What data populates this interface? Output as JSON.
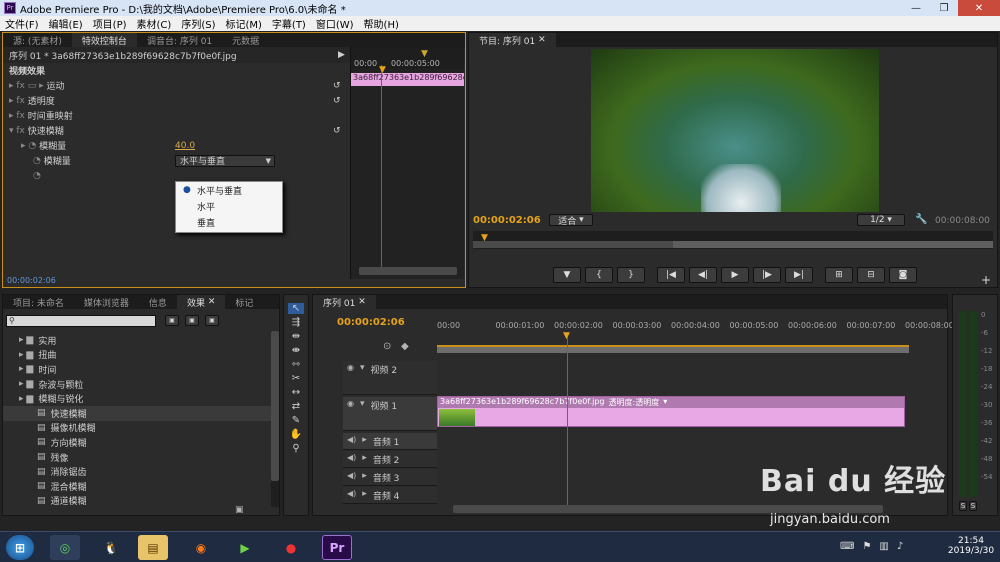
{
  "window": {
    "title": "Adobe Premiere Pro - D:\\我的文档\\Adobe\\Premiere Pro\\6.0\\未命名 *",
    "badge": "Pr"
  },
  "menu": [
    "文件(F)",
    "编辑(E)",
    "项目(P)",
    "素材(C)",
    "序列(S)",
    "标记(M)",
    "字幕(T)",
    "窗口(W)",
    "帮助(H)"
  ],
  "left_top": {
    "tabs": [
      "源: (无素材)",
      "特效控制台",
      "调音台: 序列 01",
      "元数据"
    ],
    "clip_header": "序列 01 * 3a68ff27363e1b289f69628c7b7f0e0f.jpg",
    "video_effects": "视频效果",
    "effects": [
      {
        "label": "运动"
      },
      {
        "label": "透明度"
      },
      {
        "label": "时间重映射"
      },
      {
        "label": "快速模糊"
      }
    ],
    "params": [
      {
        "label": "模糊量",
        "value": "40.0"
      },
      {
        "label": "模糊量",
        "value": "水平与垂直"
      }
    ],
    "dropdown": [
      "水平与垂直",
      "水平",
      "垂直"
    ],
    "mini_ruler": [
      "00:00",
      "00:00:05:00"
    ],
    "mini_clip": "3a68ff27363e1b289f69628c",
    "timecode": "00:00:02:06"
  },
  "program": {
    "tab": "节目: 序列 01",
    "timecode": "00:00:02:06",
    "fit": "适合",
    "ratio": "1/2",
    "duration": "00:00:08:00",
    "transport": [
      "▼",
      "{",
      "}",
      "|◀",
      "◀|",
      "▶",
      "|▶",
      "▶|",
      "⊞",
      "⊟",
      "◙"
    ]
  },
  "project": {
    "tabs": [
      "项目: 未命名",
      "媒体浏览器",
      "信息",
      "效果",
      "标记"
    ],
    "tree": [
      {
        "label": "实用",
        "level": 1
      },
      {
        "label": "扭曲",
        "level": 1
      },
      {
        "label": "时间",
        "level": 1
      },
      {
        "label": "杂波与颗粒",
        "level": 1
      },
      {
        "label": "模糊与锐化",
        "level": 1
      },
      {
        "label": "快速模糊",
        "level": 2
      },
      {
        "label": "摄像机模糊",
        "level": 2
      },
      {
        "label": "方向模糊",
        "level": 2
      },
      {
        "label": "残像",
        "level": 2
      },
      {
        "label": "消除锯齿",
        "level": 2
      },
      {
        "label": "混合模糊",
        "level": 2
      },
      {
        "label": "通道模糊",
        "level": 2
      }
    ]
  },
  "timeline": {
    "tab": "序列 01",
    "timecode": "00:00:02:06",
    "ruler": [
      "00:00",
      "00:00:01:00",
      "00:00:02:00",
      "00:00:03:00",
      "00:00:04:00",
      "00:00:05:00",
      "00:00:06:00",
      "00:00:07:00",
      "00:00:08:00"
    ],
    "tracks": [
      {
        "name": "视频 2",
        "type": "video"
      },
      {
        "name": "视频 1",
        "type": "video"
      },
      {
        "name": "音频 1",
        "type": "audio"
      },
      {
        "name": "音频 2",
        "type": "audio"
      },
      {
        "name": "音频 3",
        "type": "audio"
      },
      {
        "name": "音频 4",
        "type": "audio"
      }
    ],
    "clip_name": "3a68ff27363e1b289f69628c7b7f0e0f.jpg",
    "clip_effect": "透明度:透明度"
  },
  "vu_scale": [
    "0",
    "-6",
    "-12",
    "-18",
    "-24",
    "-30",
    "-36",
    "-42",
    "-48",
    "-54"
  ],
  "vu_buttons": [
    "S",
    "S"
  ],
  "taskbar": {
    "time": "21:54",
    "date": "2019/3/30",
    "pr": "Pr"
  },
  "watermark": {
    "brand": "Bai du 经验",
    "url": "jingyan.baidu.com"
  }
}
